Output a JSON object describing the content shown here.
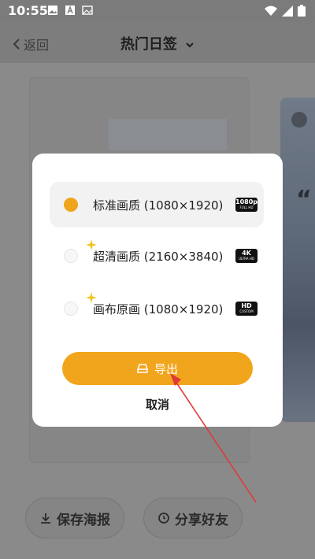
{
  "status_bar": {
    "time": "10:55"
  },
  "header": {
    "back_label": "返回",
    "title": "热门日签"
  },
  "bottom": {
    "save_label": "保存海报",
    "share_label": "分享好友"
  },
  "side_card": {
    "quote_mark": "“"
  },
  "dialog": {
    "options": [
      {
        "label": "标准画质 (1080×1920)",
        "badge": "1080p",
        "badge_sub": "FULL HD",
        "selected": true
      },
      {
        "label": "超清画质 (2160×3840)",
        "badge": "4K",
        "badge_sub": "ULTRA HD",
        "selected": false
      },
      {
        "label": "画布原画 (1080×1920)",
        "badge": "HD",
        "badge_sub": "CUSTOM",
        "selected": false
      }
    ],
    "export_label": "导出",
    "cancel_label": "取消"
  },
  "colors": {
    "accent": "#f1a51c",
    "annotation": "#e03a3a"
  }
}
